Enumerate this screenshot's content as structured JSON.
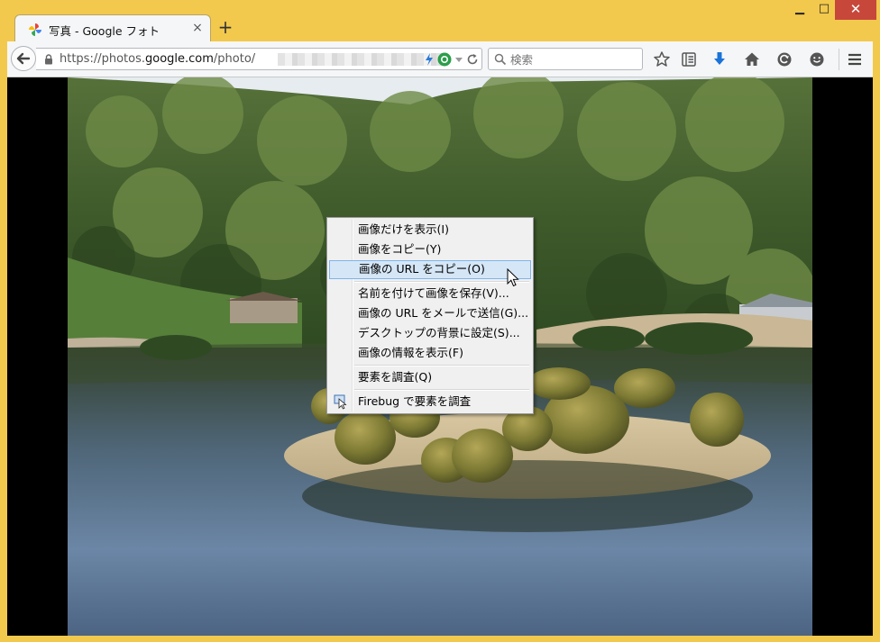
{
  "browser": {
    "tab_title": "写真 - Google フォト",
    "tab_close": "×",
    "new_tab": "+",
    "window_minimize": "▁",
    "window_maximize": "□",
    "window_close": "✕"
  },
  "navbar": {
    "url_prefix": "https://photos.",
    "url_domain": "google.com",
    "url_path": "/photo/",
    "search_placeholder": "検索"
  },
  "icons": {
    "back": "back-arrow-icon",
    "lock": "lock-icon",
    "bolt": "lightning-icon",
    "addon": "green-shield-icon",
    "dropdown": "dropdown-arrow-icon",
    "reload": "reload-icon",
    "search": "search-icon",
    "bookmark": "star-icon",
    "reading_list": "reading-list-icon",
    "downloads": "download-icon",
    "home": "home-icon",
    "history": "history-icon",
    "smiley": "smiley-icon",
    "menu": "hamburger-menu-icon"
  },
  "context_menu": {
    "items": [
      {
        "label": "画像だけを表示(I)"
      },
      {
        "label": "画像をコピー(Y)"
      },
      {
        "label": "画像の URL をコピー(O)"
      },
      {
        "label": "名前を付けて画像を保存(V)..."
      },
      {
        "label": "画像の URL をメールで送信(G)..."
      },
      {
        "label": "デスクトップの背景に設定(S)..."
      },
      {
        "label": "画像の情報を表示(F)"
      },
      {
        "label": "要素を調査(Q)"
      },
      {
        "label": "Firebug で要素を調査"
      }
    ],
    "highlighted_index": 2
  },
  "colors": {
    "window_frame": "#f2c94c",
    "close_button": "#c7473b",
    "menu_highlight": "#d5e6f6",
    "download_blue": "#1a73d9"
  }
}
